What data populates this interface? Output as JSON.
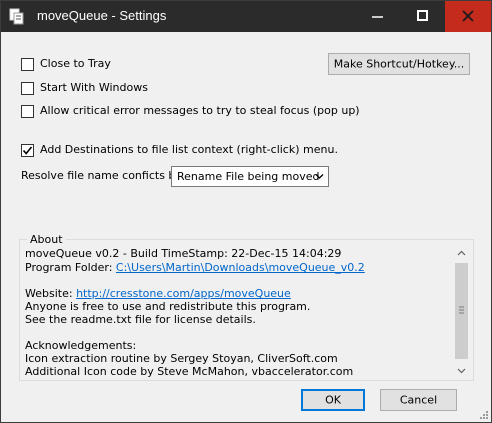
{
  "window": {
    "title": "moveQueue - Settings"
  },
  "options": {
    "close_to_tray": {
      "label": "Close to Tray",
      "checked": false
    },
    "start_with_windows": {
      "label": "Start With Windows",
      "checked": false
    },
    "allow_focus": {
      "label": "Allow critical error messages to try to steal focus (pop up)",
      "checked": false
    },
    "add_destinations": {
      "label": "Add Destinations to file list context (right-click) menu.",
      "checked": true
    }
  },
  "shortcut_button": "Make Shortcut/Hotkey...",
  "resolve": {
    "label": "Resolve file name conficts by:",
    "selected": "Rename File being moved"
  },
  "about": {
    "title": "About",
    "version_line": "moveQueue v0.2   -   Build TimeStamp: 22-Dec-15 14:04:29",
    "folder_label": "Program Folder: ",
    "folder_link": "C:\\Users\\Martin\\Downloads\\moveQueue_v0.2",
    "website_label": "Website: ",
    "website_link": "http://cresstone.com/apps/moveQueue",
    "free_line": "Anyone is free to use and redistribute this program.",
    "readme_line": "See the readme.txt file for license details.",
    "ack_title": "Acknowledgements:",
    "ack_1": "Icon extraction routine by Sergey Stoyan, CliverSoft.com",
    "ack_2": "Additional Icon code by Steve McMahon, vbaccelerator.com"
  },
  "buttons": {
    "ok": "OK",
    "cancel": "Cancel"
  }
}
